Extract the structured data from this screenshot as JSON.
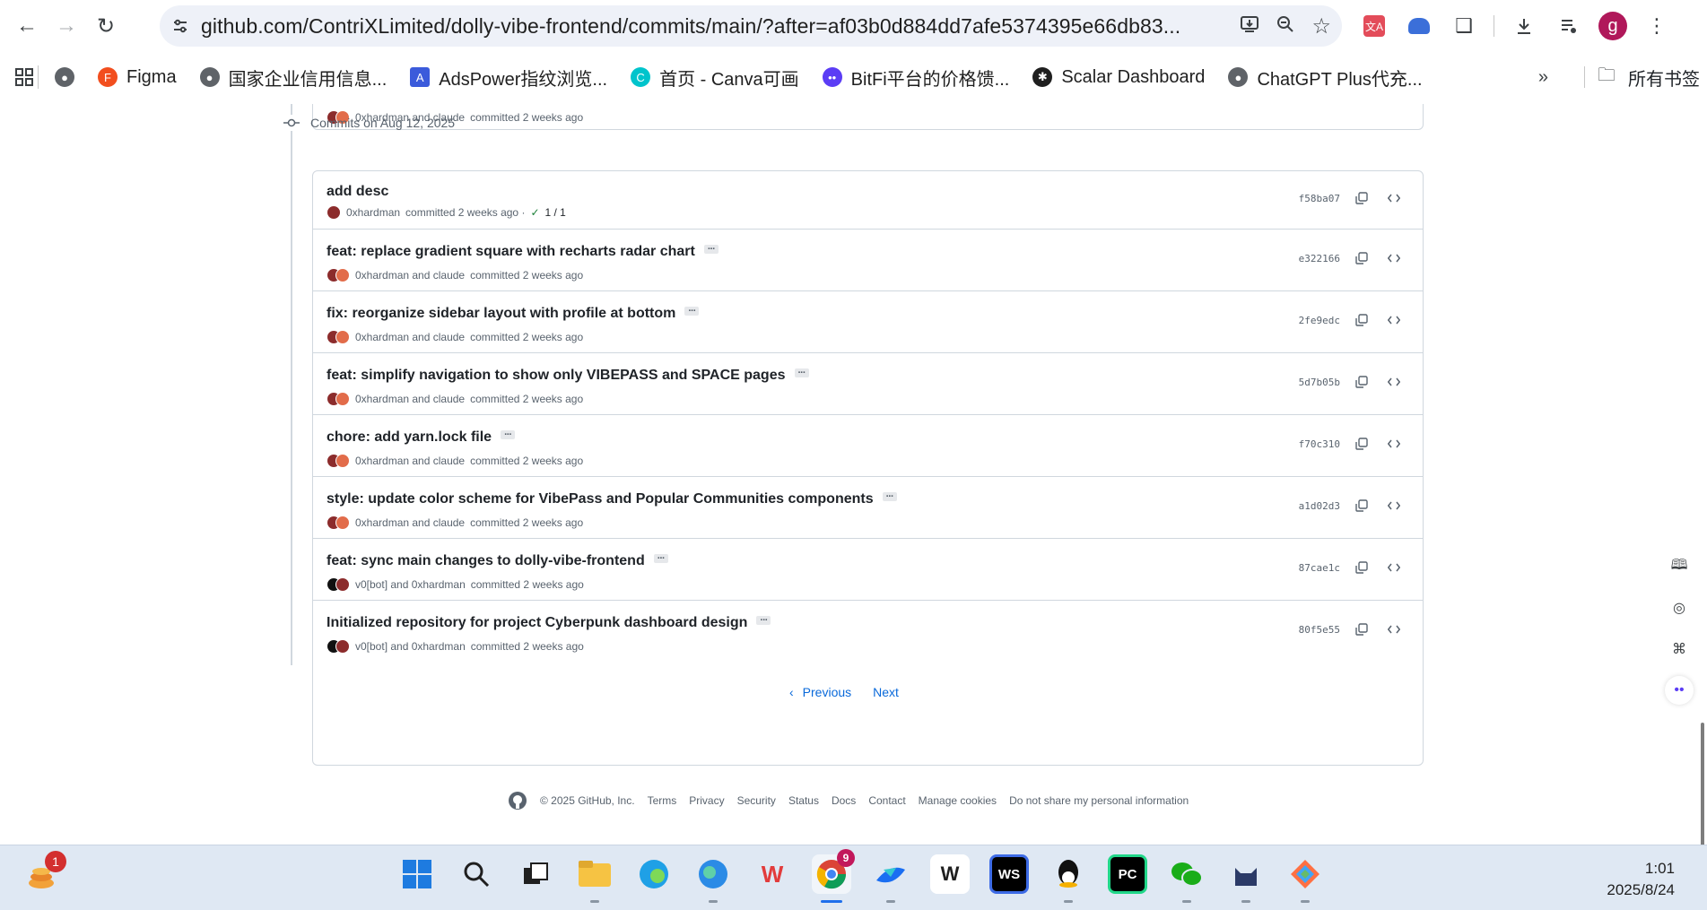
{
  "browser": {
    "url": "github.com/ContriXLimited/dolly-vibe-frontend/commits/main/?after=af03b0d884dd7afe5374395e66db83...",
    "profile_initial": "g"
  },
  "bookmarks": {
    "items": [
      {
        "label": "Figma",
        "icon": "figma-icon",
        "color": "#f24e1e"
      },
      {
        "label": "国家企业信用信息...",
        "icon": "globe-icon",
        "color": "#5f6368"
      },
      {
        "label": "AdsPower指纹浏览...",
        "icon": "adspower-icon",
        "color": "#3b5bdb"
      },
      {
        "label": "首页 - Canva可画",
        "icon": "canva-icon",
        "color": "#00c4cc"
      },
      {
        "label": "BitFi平台的价格馈...",
        "icon": "bitfi-icon",
        "color": "#5b3df5"
      },
      {
        "label": "Scalar Dashboard",
        "icon": "scalar-icon",
        "color": "#1f1f1f"
      },
      {
        "label": "ChatGPT Plus代充...",
        "icon": "globe-icon",
        "color": "#5f6368"
      }
    ],
    "all_bookmarks": "所有书签"
  },
  "commits": {
    "prev_meta": {
      "authors": "0xhardman and claude",
      "text": "committed 2 weeks ago"
    },
    "day_header": "Commits on Aug 12, 2025",
    "rows": [
      {
        "title": "add desc",
        "authors": "0xhardman",
        "text": "committed 2 weeks ago ·",
        "checks": "1 / 1",
        "hash": "f58ba07",
        "bot": false,
        "more": false
      },
      {
        "title": "feat: replace gradient square with recharts radar chart",
        "authors": "0xhardman and claude",
        "text": "committed 2 weeks ago",
        "hash": "e322166",
        "bot": false,
        "more": true
      },
      {
        "title": "fix: reorganize sidebar layout with profile at bottom",
        "authors": "0xhardman and claude",
        "text": "committed 2 weeks ago",
        "hash": "2fe9edc",
        "bot": false,
        "more": true
      },
      {
        "title": "feat: simplify navigation to show only VIBEPASS and SPACE pages",
        "authors": "0xhardman and claude",
        "text": "committed 2 weeks ago",
        "hash": "5d7b05b",
        "bot": false,
        "more": true
      },
      {
        "title": "chore: add yarn.lock file",
        "authors": "0xhardman and claude",
        "text": "committed 2 weeks ago",
        "hash": "f70c310",
        "bot": false,
        "more": true
      },
      {
        "title": "style: update color scheme for VibePass and Popular Communities components",
        "authors": "0xhardman and claude",
        "text": "committed 2 weeks ago",
        "hash": "a1d02d3",
        "bot": false,
        "more": true
      },
      {
        "title": "feat: sync main changes to dolly-vibe-frontend",
        "authors": "v0[bot] and 0xhardman",
        "text": "committed 2 weeks ago",
        "hash": "87cae1c",
        "bot": true,
        "more": true
      },
      {
        "title": "Initialized repository for project Cyberpunk dashboard design",
        "authors": "v0[bot] and 0xhardman",
        "text": "committed 2 weeks ago",
        "hash": "80f5e55",
        "bot": true,
        "more": true
      }
    ]
  },
  "pager": {
    "previous": "Previous",
    "next": "Next"
  },
  "footer": {
    "copyright": "© 2025 GitHub, Inc.",
    "links": [
      "Terms",
      "Privacy",
      "Security",
      "Status",
      "Docs",
      "Contact",
      "Manage cookies",
      "Do not share my personal information"
    ]
  },
  "taskbar": {
    "widget_badge": "1",
    "chrome_badge": "9",
    "clock_time": "1:01",
    "clock_date": "2025/8/24"
  }
}
